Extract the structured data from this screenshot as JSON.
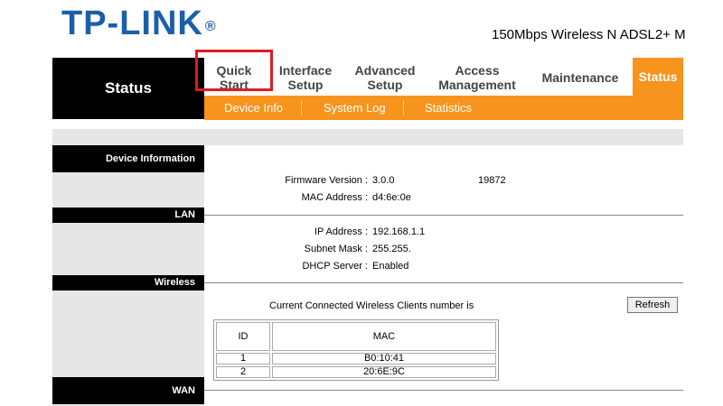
{
  "header": {
    "logo_text": "TP-LINK",
    "logo_mark": "®",
    "model": "150Mbps Wireless N ADSL2+ M"
  },
  "sidebar_title": "Status",
  "nav": {
    "items": [
      {
        "line1": "Quick",
        "line2": "Start"
      },
      {
        "line1": "Interface",
        "line2": "Setup"
      },
      {
        "line1": "Advanced",
        "line2": "Setup"
      },
      {
        "line1": "Access",
        "line2": "Management"
      },
      {
        "line1": "Maintenance",
        "line2": ""
      }
    ],
    "active": "Status"
  },
  "subnav": {
    "items": [
      "Device Info",
      "System Log",
      "Statistics"
    ]
  },
  "sections": {
    "device_info": {
      "title": "Device Information",
      "firmware_label": "Firmware Version :",
      "firmware_value": "3.0.0",
      "firmware_extra": "19872",
      "mac_label": "MAC Address :",
      "mac_value": "d4:6e:0e"
    },
    "lan": {
      "title": "LAN",
      "ip_label": "IP Address :",
      "ip_value": "192.168.1.1",
      "subnet_label": "Subnet Mask :",
      "subnet_value": "255.255.",
      "dhcp_label": "DHCP Server :",
      "dhcp_value": "Enabled"
    },
    "wireless": {
      "title": "Wireless",
      "clients_text": "Current Connected Wireless Clients number is",
      "refresh_label": "Refresh",
      "table": {
        "headers": [
          "ID",
          "MAC"
        ],
        "rows": [
          {
            "id": "1",
            "mac": "B0:10:41"
          },
          {
            "id": "2",
            "mac": "20:6E:9C"
          }
        ]
      }
    },
    "wan": {
      "title": "WAN"
    }
  },
  "colors": {
    "accent": "#f7941d",
    "logo": "#1b5faa",
    "highlight": "#e01b22"
  }
}
